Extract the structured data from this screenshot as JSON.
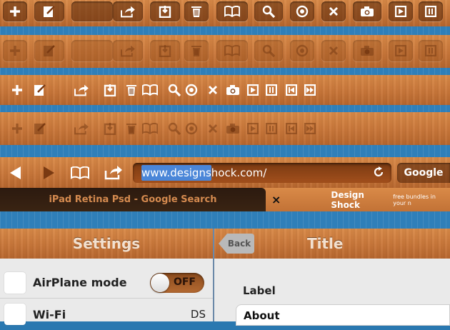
{
  "toolbar_rows": [
    {
      "style": "button-normal"
    },
    {
      "style": "button-faded"
    },
    {
      "style": "icon-normal"
    },
    {
      "style": "icon-faded"
    }
  ],
  "icons": [
    "plus-icon",
    "edit-icon",
    "blank",
    "share-icon",
    "bookmark-add-icon",
    "trash-icon",
    "book-icon",
    "search-icon",
    "target-icon",
    "close-icon",
    "camera-icon",
    "play-icon",
    "pause-icon",
    "rewind-icon",
    "fast-forward-icon"
  ],
  "browser": {
    "url_selected": "www.designs",
    "url_rest": "hock.com/",
    "search_button": "Google",
    "tabs": [
      {
        "title": "iPad Retina Psd - Google Search",
        "active": true
      },
      {
        "title": "Design Shock",
        "subtitle": "free bundles in your n"
      }
    ],
    "tab_close": "×"
  },
  "settings": {
    "title": "Settings",
    "rows": [
      {
        "label": "AirPlane mode",
        "toggle": "OFF"
      },
      {
        "label": "Wi-Fi",
        "value": "DS"
      }
    ]
  },
  "detail": {
    "back": "Back",
    "title": "Title",
    "label": "Label",
    "field": "About"
  },
  "colors": {
    "wood": "#c9773a",
    "blue": "#2f7fb9",
    "url_bg": "#8e4518",
    "selection": "#4a86d8"
  }
}
